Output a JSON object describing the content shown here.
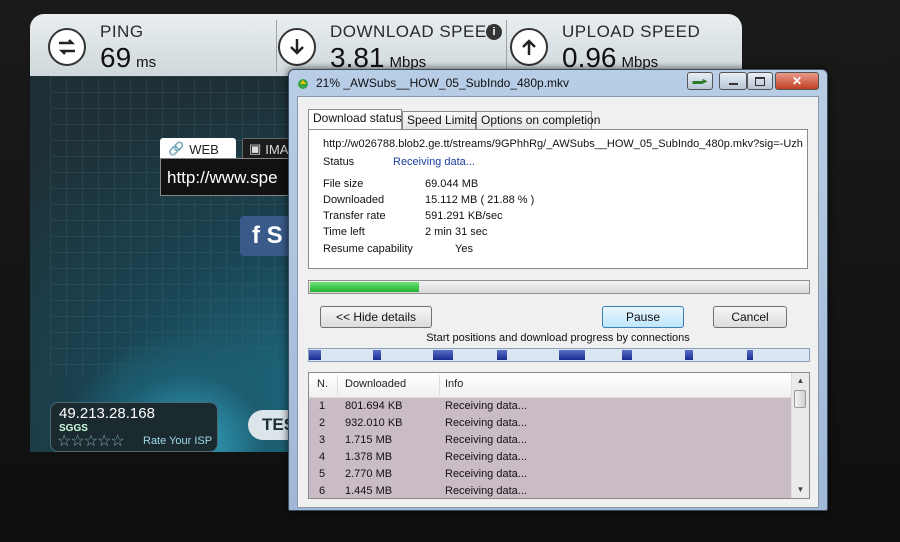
{
  "speedtest": {
    "ping": {
      "label": "PING",
      "value": "69",
      "unit": "ms"
    },
    "download": {
      "label": "DOWNLOAD SPEED",
      "value": "3.81",
      "unit": "Mbps"
    },
    "upload": {
      "label": "UPLOAD SPEED",
      "value": "0.96",
      "unit": "Mbps"
    },
    "share_tab_web": "WEB",
    "share_tab_image": "IMA",
    "share_url": "http://www.spe",
    "facebook_label": "f  S",
    "ip": "49.213.28.168",
    "isp": "SGGS",
    "rate_isp": "Rate Your ISP",
    "test_button": "TES"
  },
  "dialog": {
    "title": "21% _AWSubs__HOW_05_SubIndo_480p.mkv",
    "tabs": [
      "Download status",
      "Speed Limiter",
      "Options on completion"
    ],
    "url": "http://w026788.blob2.ge.tt/streams/9GPhhRg/_AWSubs__HOW_05_SubIndo_480p.mkv?sig=-Uzh",
    "status_label": "Status",
    "status_value": "Receiving data...",
    "file_size_label": "File size",
    "file_size_value": "69.044  MB",
    "downloaded_label": "Downloaded",
    "downloaded_value": "15.112  MB  ( 21.88 % )",
    "transfer_rate_label": "Transfer rate",
    "transfer_rate_value": "591.291  KB/sec",
    "time_left_label": "Time left",
    "time_left_value": "2 min 31 sec",
    "resume_label": "Resume capability",
    "resume_value": "Yes",
    "progress_fraction": 0.2188,
    "hide_details_button": "<< Hide details",
    "pause_button": "Pause",
    "cancel_button": "Cancel",
    "connections_label": "Start positions and download progress by connections",
    "table": {
      "headers": [
        "N.",
        "Downloaded",
        "Info"
      ],
      "rows": [
        {
          "n": "1",
          "downloaded": "801.694  KB",
          "info": "Receiving data..."
        },
        {
          "n": "2",
          "downloaded": "932.010  KB",
          "info": "Receiving data..."
        },
        {
          "n": "3",
          "downloaded": "1.715  MB",
          "info": "Receiving data..."
        },
        {
          "n": "4",
          "downloaded": "1.378  MB",
          "info": "Receiving data..."
        },
        {
          "n": "5",
          "downloaded": "2.770  MB",
          "info": "Receiving data..."
        },
        {
          "n": "6",
          "downloaded": "1.445  MB",
          "info": "Receiving data..."
        }
      ]
    }
  },
  "colors": {
    "progress": "#1fb22e",
    "row_bg": "#c9bcc6",
    "status_text": "#1a3ea0"
  },
  "icons": [
    "ping-icon",
    "download-icon",
    "upload-icon",
    "info-icon",
    "link-icon",
    "image-icon",
    "facebook-icon",
    "star-icon",
    "app-icon",
    "minimize-icon",
    "maximize-icon",
    "close-icon",
    "scroll-up-icon",
    "scroll-down-icon"
  ]
}
